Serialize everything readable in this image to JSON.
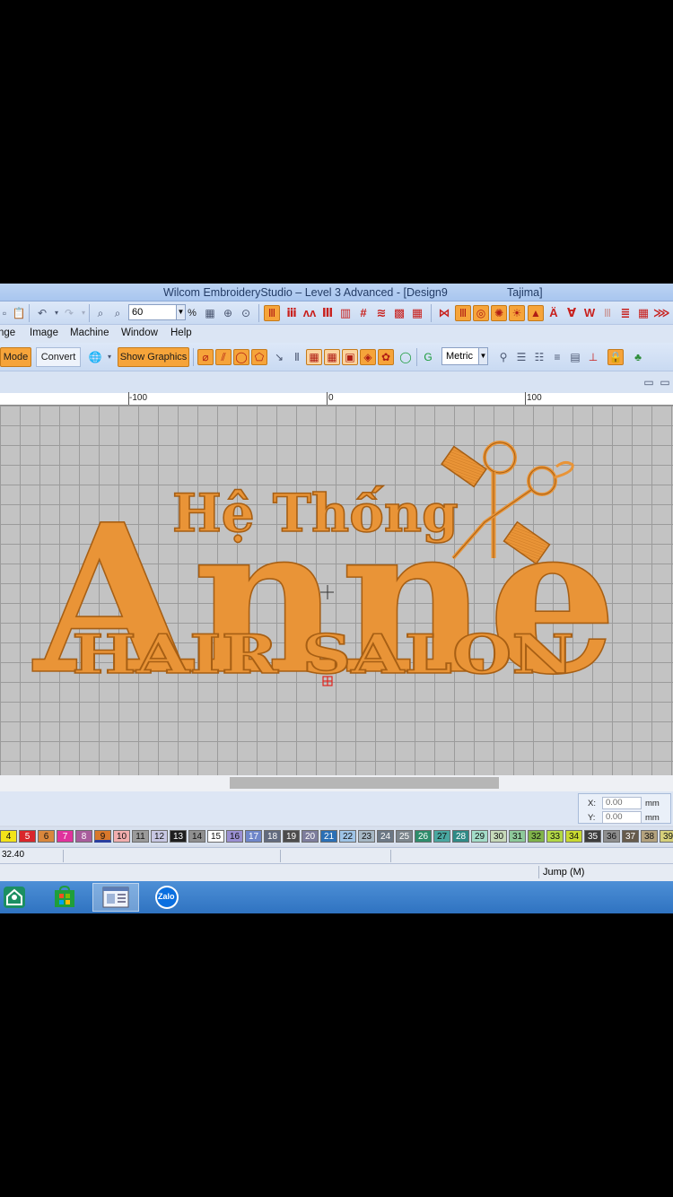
{
  "window": {
    "title": "Wilcom EmbroideryStudio – Level 3 Advanced - [Design9",
    "title_suffix": "Tajima]"
  },
  "toolbar1": {
    "zoom_value": "60",
    "zoom_unit": "%"
  },
  "menu": {
    "items": [
      "nge",
      "Image",
      "Machine",
      "Window",
      "Help"
    ]
  },
  "toolbar2": {
    "mode_label": "Mode",
    "convert_label": "Convert",
    "show_graphics_label": "Show Graphics",
    "units_value": "Metric"
  },
  "ruler": {
    "labels": [
      "-100",
      "0",
      "100"
    ]
  },
  "design": {
    "line1": "Hệ Thống",
    "line2": "Anne",
    "line3": "HAIR SALON",
    "thread_color": "#e99437",
    "outline_color": "#a75f14"
  },
  "coords": {
    "x_label": "X:",
    "x_value": "0.00",
    "y_label": "Y:",
    "y_value": "0.00",
    "unit": "mm"
  },
  "palette": [
    {
      "n": "4",
      "c": "#f3e319"
    },
    {
      "n": "5",
      "c": "#d9262b",
      "dark": true
    },
    {
      "n": "6",
      "c": "#d9873c"
    },
    {
      "n": "7",
      "c": "#e0329d",
      "dark": true
    },
    {
      "n": "8",
      "c": "#a85c9c",
      "dark": true
    },
    {
      "n": "9",
      "c": "#d9782b",
      "sel": true
    },
    {
      "n": "10",
      "c": "#f2aeae"
    },
    {
      "n": "11",
      "c": "#9a9a9a"
    },
    {
      "n": "12",
      "c": "#c7c7e3"
    },
    {
      "n": "13",
      "c": "#1e1e1e",
      "dark": true
    },
    {
      "n": "14",
      "c": "#8f8f8f"
    },
    {
      "n": "15",
      "c": "#ffffff"
    },
    {
      "n": "16",
      "c": "#9a8fd2"
    },
    {
      "n": "17",
      "c": "#6f86c9",
      "dark": true
    },
    {
      "n": "18",
      "c": "#616a7e",
      "dark": true
    },
    {
      "n": "19",
      "c": "#4c4c4c",
      "dark": true
    },
    {
      "n": "20",
      "c": "#7c7c9c",
      "dark": true
    },
    {
      "n": "21",
      "c": "#2a6fb5",
      "dark": true
    },
    {
      "n": "22",
      "c": "#9ec3e6"
    },
    {
      "n": "23",
      "c": "#a6b7c4"
    },
    {
      "n": "24",
      "c": "#6c7885",
      "dark": true
    },
    {
      "n": "25",
      "c": "#7b858c",
      "dark": true
    },
    {
      "n": "26",
      "c": "#2e8c6b",
      "dark": true
    },
    {
      "n": "27",
      "c": "#49a7a0"
    },
    {
      "n": "28",
      "c": "#2f8a86",
      "dark": true
    },
    {
      "n": "29",
      "c": "#a3dcc8"
    },
    {
      "n": "30",
      "c": "#c6d9b9"
    },
    {
      "n": "31",
      "c": "#8dc99a"
    },
    {
      "n": "32",
      "c": "#7fb34a"
    },
    {
      "n": "33",
      "c": "#b2d845"
    },
    {
      "n": "34",
      "c": "#c8d930"
    },
    {
      "n": "35",
      "c": "#3d3d3d",
      "dark": true
    },
    {
      "n": "36",
      "c": "#8e8e8e"
    },
    {
      "n": "37",
      "c": "#665b4c",
      "dark": true
    },
    {
      "n": "38",
      "c": "#b3a27e"
    },
    {
      "n": "39",
      "c": "#d6d07a"
    }
  ],
  "status": {
    "left_value": "32.40",
    "right_text": "Jump (M)"
  },
  "taskbar": {
    "zalo_label": "Zalo"
  }
}
